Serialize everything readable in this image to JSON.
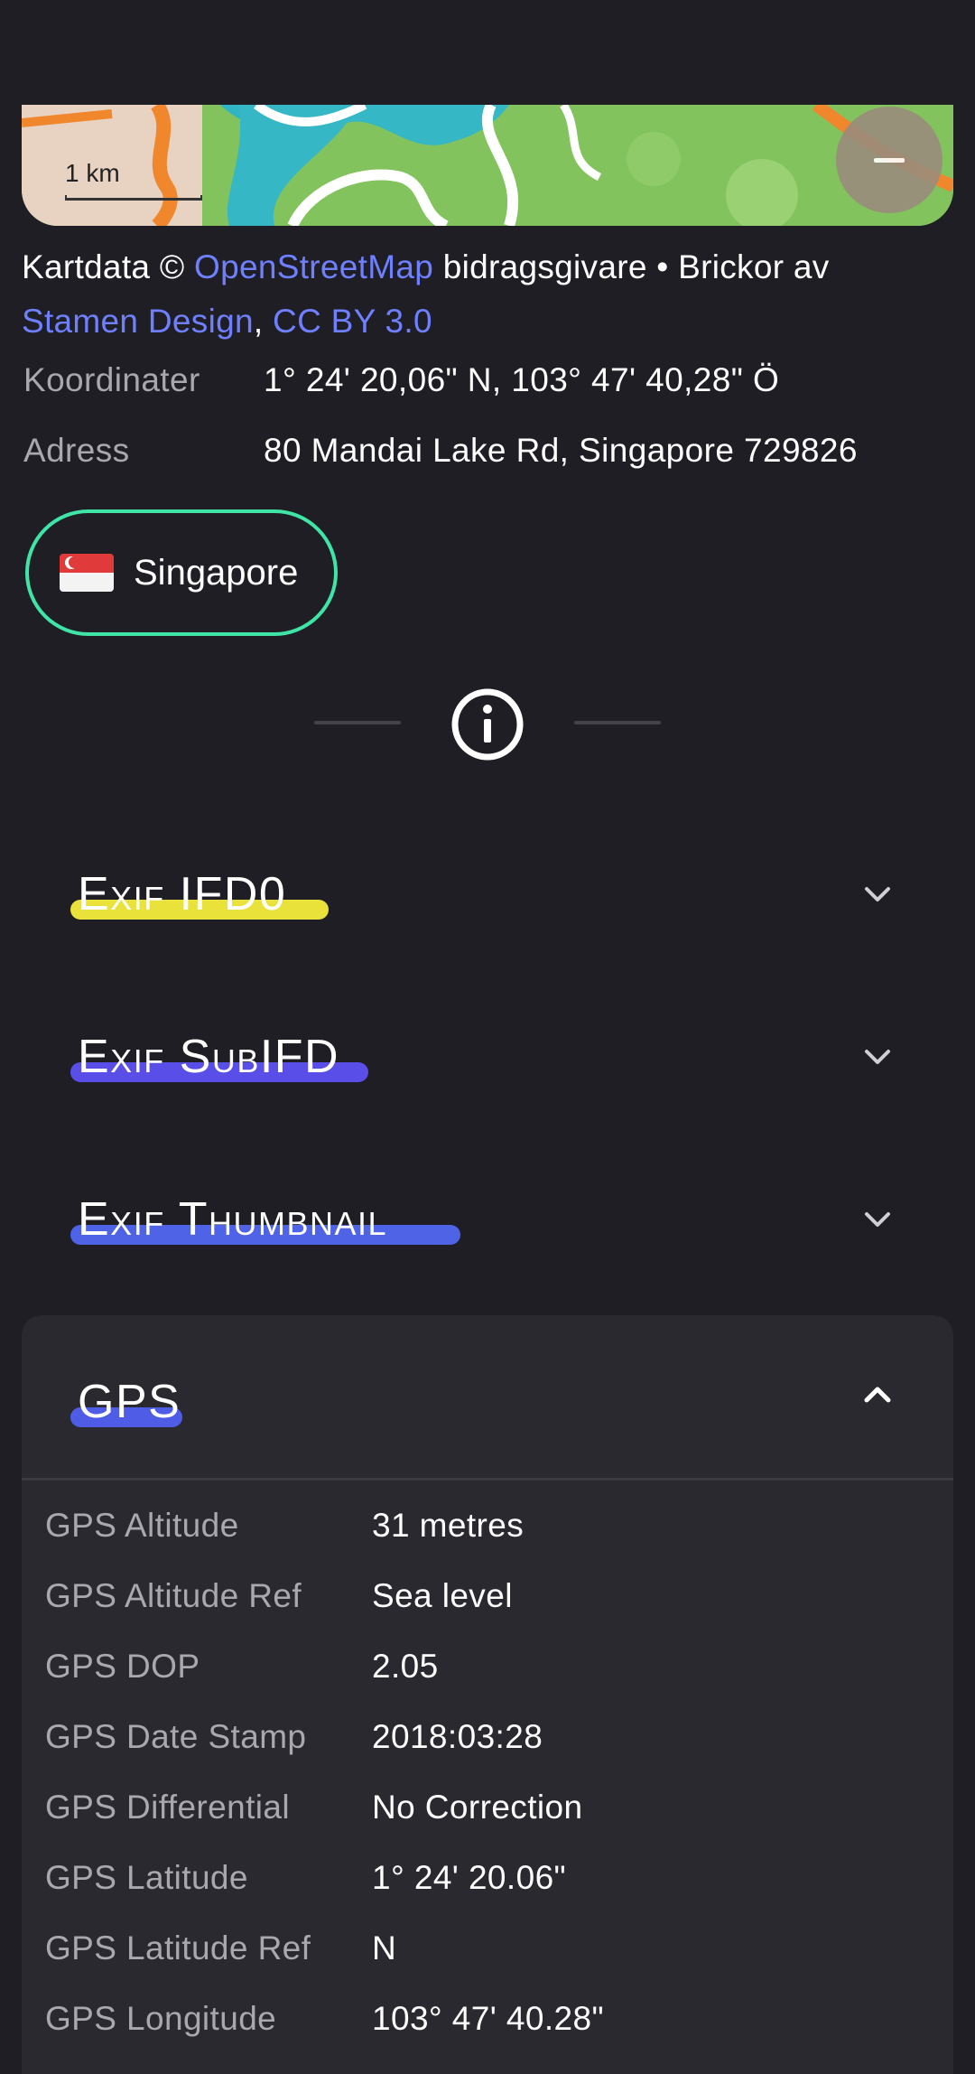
{
  "map": {
    "scale_label": "1 km",
    "zoom_out_label": "Zoom out"
  },
  "attribution": {
    "prefix": "Kartdata © ",
    "osm_link": "OpenStreetMap",
    "middle": " bidragsgivare • Brickor av",
    "stamen_link": "Stamen Design",
    "comma": ", ",
    "license_link": "CC BY 3.0"
  },
  "location": {
    "coords_label": "Koordinater",
    "coords_value": "1° 24' 20,06\" N, 103° 47' 40,28\" Ö",
    "address_label": "Adress",
    "address_value": "80 Mandai Lake Rd, Singapore 729826",
    "country_chip": "Singapore"
  },
  "sections": [
    {
      "title": "Exif IFD0",
      "highlight": "#e8e23a",
      "expanded": false
    },
    {
      "title": "Exif SubIFD",
      "highlight": "#5a4ee8",
      "expanded": false
    },
    {
      "title": "Exif Thumbnail",
      "highlight": "#4f63e6",
      "expanded": false
    },
    {
      "title": "GPS",
      "highlight": "#4f5ce6",
      "expanded": true
    }
  ],
  "gps_rows": [
    {
      "label": "GPS Altitude",
      "value": "31 metres"
    },
    {
      "label": "GPS Altitude Ref",
      "value": "Sea level"
    },
    {
      "label": "GPS DOP",
      "value": "2.05"
    },
    {
      "label": "GPS Date Stamp",
      "value": "2018:03:28"
    },
    {
      "label": "GPS Differential",
      "value": "No Correction"
    },
    {
      "label": "GPS Latitude",
      "value": "1° 24' 20.06\""
    },
    {
      "label": "GPS Latitude Ref",
      "value": "N"
    },
    {
      "label": "GPS Longitude",
      "value": "103° 47' 40.28\""
    }
  ]
}
